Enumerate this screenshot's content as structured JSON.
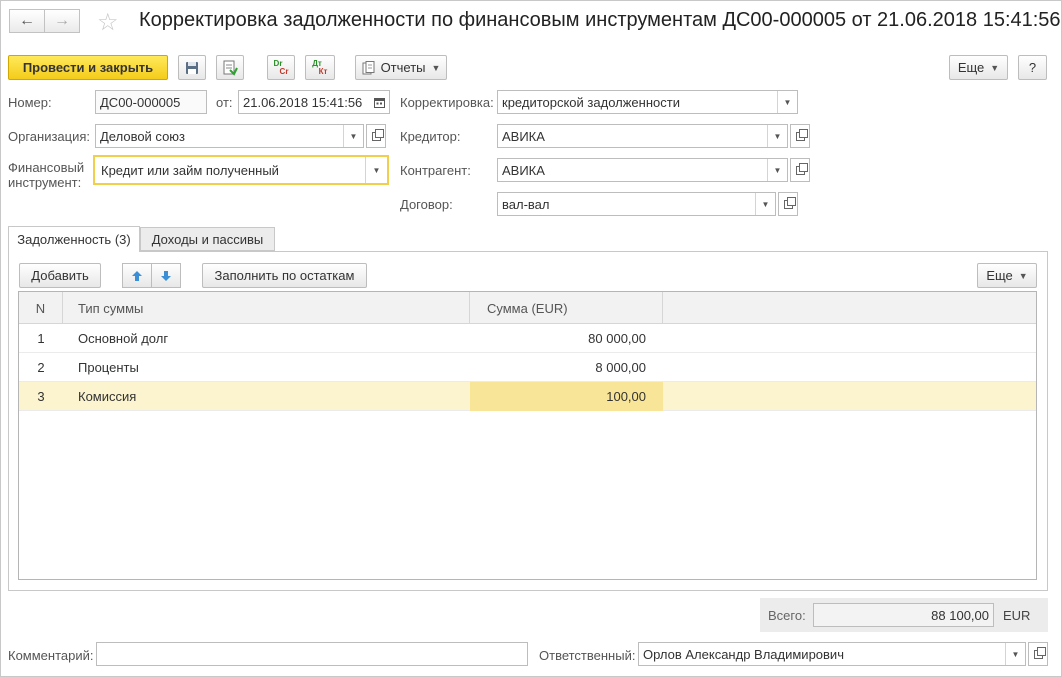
{
  "window": {
    "title": "Корректировка задолженности по финансовым инструментам ДС00-000005 от 21.06.2018 15:41:56"
  },
  "toolbar": {
    "post_and_close": "Провести и закрыть",
    "dr_label": "Dr",
    "cr_label": "Cr",
    "dt_label": "Дт",
    "kt_label": "Кт",
    "reports": "Отчеты",
    "more": "Еще",
    "help": "?"
  },
  "form": {
    "number_label": "Номер:",
    "number_value": "ДС00-000005",
    "date_label": "от:",
    "date_value": "21.06.2018 15:41:56",
    "organization_label": "Организация:",
    "organization_value": "Деловой союз",
    "instrument_label_1": "Финансовый",
    "instrument_label_2": "инструмент:",
    "instrument_value": "Кредит или займ полученный",
    "correction_label": "Корректировка:",
    "correction_value": "кредиторской задолженности",
    "creditor_label": "Кредитор:",
    "creditor_value": "АВИКА",
    "counterparty_label": "Контрагент:",
    "counterparty_value": "АВИКА",
    "contract_label": "Договор:",
    "contract_value": "вал-вал"
  },
  "tabs": [
    {
      "label": "Задолженность (3)",
      "active": true
    },
    {
      "label": "Доходы и пассивы",
      "active": false
    }
  ],
  "table_toolbar": {
    "add": "Добавить",
    "fill": "Заполнить по остаткам",
    "more": "Еще"
  },
  "table": {
    "headers": [
      "N",
      "Тип суммы",
      "Сумма (EUR)"
    ],
    "rows": [
      {
        "n": "1",
        "type": "Основной долг",
        "amount": "80 000,00"
      },
      {
        "n": "2",
        "type": "Проценты",
        "amount": "8 000,00"
      },
      {
        "n": "3",
        "type": "Комиссия",
        "amount": "100,00"
      }
    ]
  },
  "total": {
    "label": "Всего:",
    "value": "88 100,00",
    "currency": "EUR"
  },
  "footer": {
    "comment_label": "Комментарий:",
    "comment_value": "",
    "responsible_label": "Ответственный:",
    "responsible_value": "Орлов Александр Владимирович"
  },
  "colors": {
    "primary_button": "#f4cc1a",
    "selected_row": "#fbf4cf",
    "active_cell": "#f8e597",
    "arrow_blue": "#3a8fd6"
  }
}
